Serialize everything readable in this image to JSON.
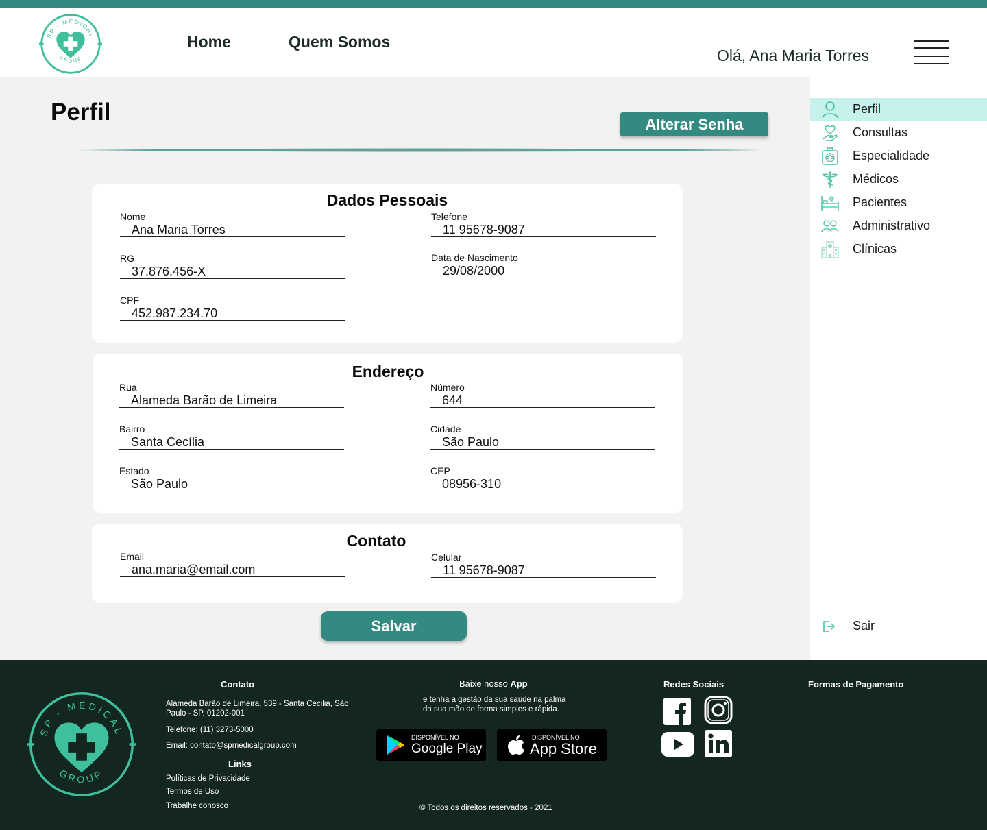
{
  "header": {
    "logo_text_top": "SP - MEDICAL",
    "logo_text_bottom": "GROUP",
    "nav": [
      "Home",
      "Quem Somos"
    ],
    "greeting": "Olá, Ana Maria Torres"
  },
  "sidebar": {
    "items": [
      {
        "label": "Perfil",
        "icon": "user-icon"
      },
      {
        "label": "Consultas",
        "icon": "heart-hand-icon"
      },
      {
        "label": "Especialidade",
        "icon": "medical-kit-icon"
      },
      {
        "label": "Médicos",
        "icon": "caduceus-icon"
      },
      {
        "label": "Pacientes",
        "icon": "hospital-bed-icon"
      },
      {
        "label": "Administrativo",
        "icon": "group-icon"
      },
      {
        "label": "Clínicas",
        "icon": "hospital-building-icon"
      }
    ],
    "logout": {
      "label": "Sair",
      "icon": "logout-icon"
    }
  },
  "main": {
    "title": "Perfil",
    "change_password_label": "Alterar Senha",
    "save_label": "Salvar",
    "personal": {
      "title": "Dados Pessoais",
      "nome": {
        "label": "Nome",
        "value": "Ana Maria Torres"
      },
      "telefone": {
        "label": "Telefone",
        "value": "11 95678-9087"
      },
      "rg": {
        "label": "RG",
        "value": "37.876.456-X"
      },
      "nascimento": {
        "label": "Data de Nascimento",
        "value": "29/08/2000"
      },
      "cpf": {
        "label": "CPF",
        "value": "452.987.234.70"
      }
    },
    "address": {
      "title": "Endereço",
      "rua": {
        "label": "Rua",
        "value": "Alameda Barão de Limeira"
      },
      "numero": {
        "label": "Número",
        "value": "644"
      },
      "bairro": {
        "label": "Bairro",
        "value": "Santa Cecília"
      },
      "cidade": {
        "label": "Cidade",
        "value": "São Paulo"
      },
      "estado": {
        "label": "Estado",
        "value": "São Paulo"
      },
      "cep": {
        "label": "CEP",
        "value": "08956-310"
      }
    },
    "contact": {
      "title": "Contato",
      "email": {
        "label": "Email",
        "value": "ana.maria@email.com"
      },
      "celular": {
        "label": "Celular",
        "value": "11 95678-9087"
      }
    }
  },
  "footer": {
    "contato_title": "Contato",
    "address": "Alameda Barão de Limeira, 539 - Santa Cecilia, São Paulo - SP, 01202-001",
    "phone": "Telefone: (11) 3273-5000",
    "email": "Email: contato@spmedicalgroup.com",
    "links_title": "Links",
    "links": [
      "Políticas de Privacidade",
      "Termos de Uso",
      "Trabalhe conosco"
    ],
    "app_title_prefix": "Baixe nosso ",
    "app_title_bold": "App",
    "app_desc_1": "e tenha a gestão da sua saúde na palma",
    "app_desc_2": "da sua mão de forma simples e rápida.",
    "google_small": "DISPONÍVEL NO",
    "google_big": "Google Play",
    "apple_small": "DISPONÍVEL NO",
    "apple_big": "App Store",
    "social_title": "Redes Sociais",
    "social_icons": [
      "facebook-icon",
      "instagram-icon",
      "youtube-icon",
      "linkedin-icon"
    ],
    "payment_title": "Formas de Pagamento",
    "copyright": "© Todos os direitos reservados - 2021"
  },
  "colors": {
    "brand": "#338a80",
    "accent": "#3fbf9c",
    "footer_bg": "#13261f",
    "sidebar_active": "#c6f1ec"
  }
}
